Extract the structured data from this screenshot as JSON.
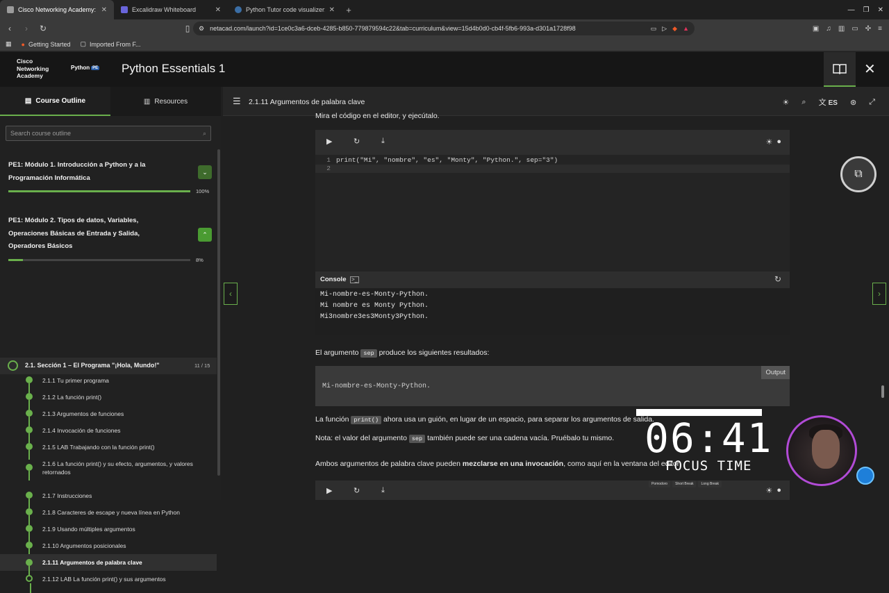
{
  "browser": {
    "tabs": [
      {
        "title": "Cisco Networking Academy: P",
        "color": "#9c9c9c"
      },
      {
        "title": "Excalidraw Whiteboard",
        "color": "#6965db"
      },
      {
        "title": "Python Tutor code visualizer: Visu",
        "color": "#3b6ea5"
      }
    ],
    "new_tab": "+",
    "url": "netacad.com/launch?id=1ce0c3a6-dceb-4285-b850-779879594c22&tab=curriculum&view=15d4b0d0-cb4f-5fb6-993a-d301a1728f98",
    "bookmarks": [
      "Getting Started",
      "Imported From F..."
    ]
  },
  "app": {
    "logo_lines": [
      "Cisco",
      "Networking",
      "Academy"
    ],
    "python_logo": "Python",
    "python_badge": "PE",
    "title": "Python Essentials 1"
  },
  "sidebar": {
    "tabs": [
      "Course Outline",
      "Resources"
    ],
    "search_placeholder": "Search course outline",
    "modules": [
      {
        "title": "PE1: Módulo 1. Introducción a Python y a la Programación Informática",
        "progress": 1.0,
        "pct": "100%"
      },
      {
        "title": "PE1: Módulo 2. Tipos de datos, Variables, Operaciones Básicas de Entrada y Salida, Operadores Básicos",
        "progress": 0.08,
        "pct": "8%"
      }
    ],
    "section": {
      "title": "2.1. Sección 1 – El Programa \"¡Hola, Mundo!\"",
      "count": "11 / 15"
    },
    "lessons": [
      "2.1.1 Tu primer programa",
      "2.1.2 La función print()",
      "2.1.3 Argumentos de funciones",
      "2.1.4 Invocación de funciones",
      "2.1.5 LAB Trabajando con la función print()",
      "2.1.6 La función print() y su efecto, argumentos, y valores retornados",
      "2.1.7 Instrucciones",
      "2.1.8 Caracteres de escape y nueva línea en Python",
      "2.1.9 Usando múltiples argumentos",
      "2.1.10 Argumentos posicionales",
      "2.1.11 Argumentos de palabra clave",
      "2.1.12 LAB La función print() y sus argumentos"
    ]
  },
  "content": {
    "page_title": "2.1.11 Argumentos de palabra clave",
    "lang": "ES",
    "intro": "Mira el código en el editor, y ejecútalo.",
    "code_lines": [
      "print(\"Mi\", \"nombre\", \"es\", \"Monty\", \"Python.\", sep=\"3\")",
      ""
    ],
    "console_label": "Console",
    "console_output": [
      "Mi-nombre-es-Monty-Python.",
      "Mi nombre es Monty Python.",
      "Mi3nombre3es3Monty3Python."
    ],
    "sep_text_a": "El argumento",
    "sep_chip": "sep",
    "sep_text_b": "produce los siguientes resultados:",
    "output_label": "Output",
    "output_text": "Mi-nombre-es-Monty-Python.",
    "p2_a": "La función",
    "p2_chip": "print()",
    "p2_b": "ahora usa un guión, en lugar de un espacio, para separar los argumentos de salida.",
    "p3_a": "Nota: el valor del argumento",
    "p3_chip": "sep",
    "p3_b": "también puede ser una cadena vacía. Pruébalo tu mismo.",
    "p4_a": "Ambos argumentos de palabra clave pueden",
    "p4_bold": "mezclarse en una invocación",
    "p4_b": ", como aquí en la ventana del editor:"
  },
  "overlay": {
    "timer": "06:41",
    "label": "FOCUS TIME",
    "modes": [
      "Pomodoro",
      "Short Break",
      "Long Break"
    ]
  }
}
